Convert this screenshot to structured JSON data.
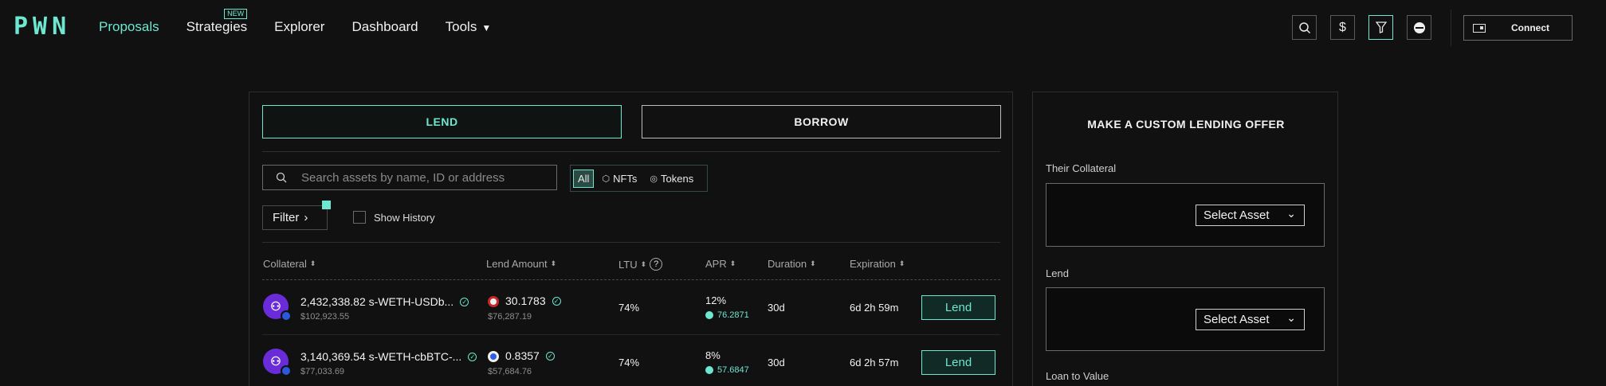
{
  "nav": {
    "logo": "PWN",
    "items": [
      {
        "label": "Proposals",
        "active": true
      },
      {
        "label": "Strategies",
        "badge": "NEW"
      },
      {
        "label": "Explorer"
      },
      {
        "label": "Dashboard"
      },
      {
        "label": "Tools"
      }
    ],
    "dollar_icon": "$",
    "connect_label": "Connect"
  },
  "main": {
    "tabs": {
      "lend": "LEND",
      "borrow": "BORROW"
    },
    "search_placeholder": "Search assets by name, ID or address",
    "segments": {
      "all": "All",
      "nfts": "NFTs",
      "tokens": "Tokens"
    },
    "filter_label": "Filter",
    "show_history_label": "Show History",
    "columns": {
      "collateral": "Collateral",
      "lend_amount": "Lend Amount",
      "ltu": "LTU",
      "apr": "APR",
      "duration": "Duration",
      "expiration": "Expiration"
    },
    "rows": [
      {
        "collateral": "2,432,338.82 s-WETH-USDb...",
        "collateral_usd": "$102,923.55",
        "amount": "30.1783",
        "amount_usd": "$76,287.19",
        "ltu": "74%",
        "apr": "12%",
        "apr_sub": "76.2871",
        "duration": "30d",
        "expiration": "6d 2h 59m",
        "action": "Lend"
      },
      {
        "collateral": "3,140,369.54 s-WETH-cbBTC-...",
        "collateral_usd": "$77,033.69",
        "amount": "0.8357",
        "amount_usd": "$57,684.76",
        "ltu": "74%",
        "apr": "8%",
        "apr_sub": "57.6847",
        "duration": "30d",
        "expiration": "6d 2h 57m",
        "action": "Lend"
      }
    ]
  },
  "side": {
    "title": "MAKE A CUSTOM LENDING OFFER",
    "their_collateral_label": "Their Collateral",
    "lend_label": "Lend",
    "select_asset_label": "Select Asset",
    "loan_to_value_label": "Loan to Value"
  },
  "colors": {
    "accent": "#6ee7d1",
    "background": "#111111",
    "avatar": "#6a2bd9"
  }
}
